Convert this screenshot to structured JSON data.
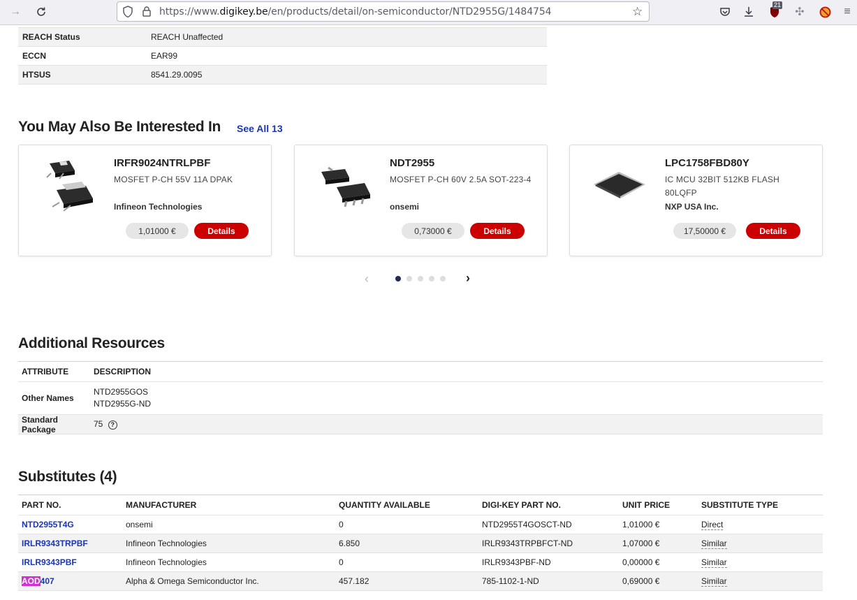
{
  "browser": {
    "url_prefix": "https://www.",
    "url_domain": "digikey.be",
    "url_path": "/en/products/detail/on-semiconductor/NTD2955G/1484754",
    "extension_badge": "21"
  },
  "specs": [
    {
      "key": "REACH Status",
      "value": "REACH Unaffected"
    },
    {
      "key": "ECCN",
      "value": "EAR99"
    },
    {
      "key": "HTSUS",
      "value": "8541.29.0095"
    }
  ],
  "recommend": {
    "title": "You May Also Be Interested In",
    "see_all": "See All 13",
    "cards": [
      {
        "title": "IRFR9024NTRLPBF",
        "desc": "MOSFET P-CH 55V 11A DPAK",
        "mfr": "Infineon Technologies",
        "price": "1,01000 €",
        "button": "Details"
      },
      {
        "title": "NDT2955",
        "desc": "MOSFET P-CH 60V 2.5A SOT-223-4",
        "mfr": "onsemi",
        "price": "0,73000 €",
        "button": "Details"
      },
      {
        "title": "LPC1758FBD80Y",
        "desc": "IC MCU 32BIT 512KB FLASH 80LQFP",
        "mfr": "NXP USA Inc.",
        "price": "17,50000 €",
        "button": "Details"
      }
    ]
  },
  "resources": {
    "title": "Additional Resources",
    "headers": [
      "ATTRIBUTE",
      "DESCRIPTION"
    ],
    "other_names_label": "Other Names",
    "other_names": [
      "NTD2955GOS",
      "NTD2955G-ND"
    ],
    "standard_package_label": "Standard Package",
    "standard_package_value": "75"
  },
  "substitutes": {
    "title": "Substitutes (4)",
    "headers": [
      "PART NO.",
      "MANUFACTURER",
      "QUANTITY AVAILABLE",
      "DIGI-KEY PART NO.",
      "UNIT PRICE",
      "SUBSTITUTE TYPE"
    ],
    "rows": [
      {
        "part_a": "",
        "part_b": "NTD2955T4G",
        "mfr": "onsemi",
        "qty": "0",
        "dk": "NTD2955T4GOSCT-ND",
        "price": "1,01000 €",
        "type": "Direct"
      },
      {
        "part_a": "",
        "part_b": "IRLR9343TRPBF",
        "mfr": "Infineon Technologies",
        "qty": "6.850",
        "dk": "IRLR9343TRPBFCT-ND",
        "price": "1,07000 €",
        "type": "Similar"
      },
      {
        "part_a": "",
        "part_b": "IRLR9343PBF",
        "mfr": "Infineon Technologies",
        "qty": "0",
        "dk": "IRLR9343PBF-ND",
        "price": "0,00000 €",
        "type": "Similar"
      },
      {
        "part_a": "AOD",
        "part_b": "407",
        "mfr": "Alpha & Omega Semiconductor Inc.",
        "qty": "457.182",
        "dk": "785-1102-1-ND",
        "price": "0,69000 €",
        "type": "Similar"
      }
    ]
  }
}
